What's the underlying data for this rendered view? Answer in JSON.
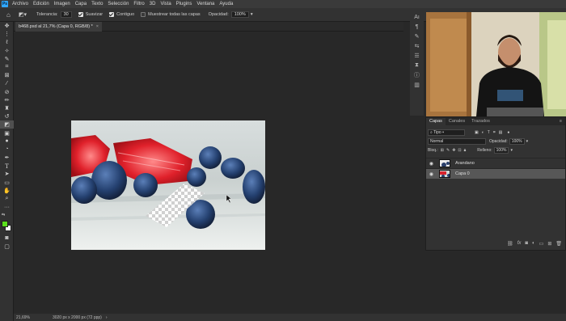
{
  "menubar": {
    "logo": "Ps",
    "items": [
      "Archivo",
      "Edición",
      "Imagen",
      "Capa",
      "Texto",
      "Selección",
      "Filtro",
      "3D",
      "Vista",
      "Plugins",
      "Ventana",
      "Ayuda"
    ]
  },
  "options": {
    "tolerance_label": "Tolerancia:",
    "tolerance_value": "30",
    "smooth_label": "Suavizar",
    "contiguous_label": "Contiguo",
    "sample_all_label": "Muestrear todas las capas",
    "opacity_label": "Opacidad:",
    "opacity_value": "100%"
  },
  "document": {
    "tab_title": "b468.psd al 21,7% (Capa 0, RGB/8) *",
    "close": "×"
  },
  "status": {
    "zoom": "21,69%",
    "size": "3020 px x 2000 px (72 ppp)"
  },
  "layers_panel": {
    "tabs": [
      "Capas",
      "Canales",
      "Trazados"
    ],
    "filter_value": "Tipo",
    "blend_mode": "Normal",
    "opacity_label": "Opacidad:",
    "opacity_value": "100%",
    "lock_label": "Bloq.:",
    "fill_label": "Relleno:",
    "fill_value": "100%",
    "layers": [
      {
        "name": "Arandano",
        "active": false
      },
      {
        "name": "Capa 0",
        "active": true
      }
    ]
  },
  "colors": {
    "foreground": "#5ce01e",
    "background": "#ffffff",
    "accent": "#31a8ff"
  }
}
